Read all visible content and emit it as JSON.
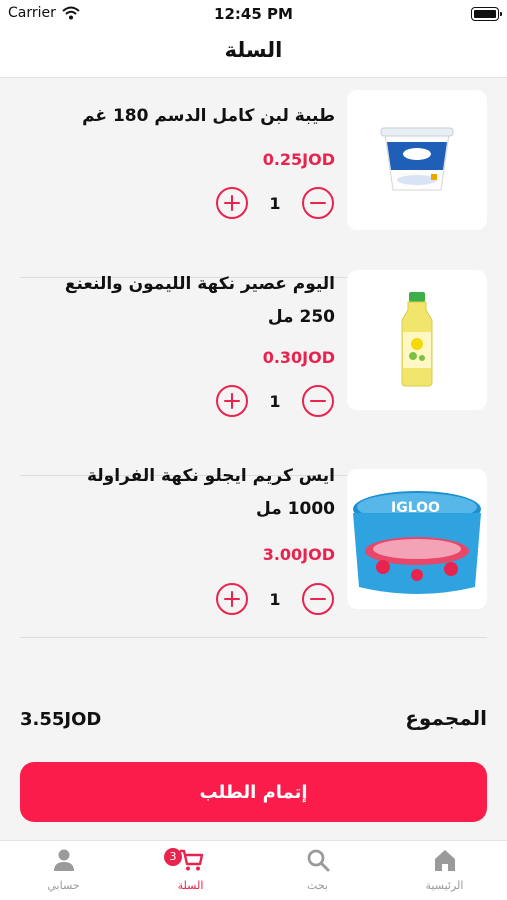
{
  "status_bar": {
    "carrier": "Carrier",
    "time": "12:45 PM"
  },
  "header": {
    "title": "السلة"
  },
  "cart": {
    "items": [
      {
        "name": "طيبة لبن كامل الدسم 180 غم",
        "price": "0.25JOD",
        "quantity": "1",
        "image_icon": "yogurt-cup-icon"
      },
      {
        "name": "اليوم عصير نكهة الليمون والنعنع 250 مل",
        "price": "0.30JOD",
        "quantity": "1",
        "image_icon": "juice-bottle-icon"
      },
      {
        "name": "ايس كريم ايجلو نكهة الفراولة 1000 مل",
        "price": "3.00JOD",
        "quantity": "1",
        "image_icon": "ice-cream-tub-icon"
      }
    ],
    "total_label": "المجموع",
    "total_value": "3.55JOD",
    "checkout_label": "إتمام الطلب"
  },
  "tab_bar": {
    "tabs": [
      {
        "label": "حسابي",
        "icon": "person-icon"
      },
      {
        "label": "السلة",
        "icon": "cart-icon",
        "badge": "3",
        "active": true
      },
      {
        "label": "بحث",
        "icon": "search-icon"
      },
      {
        "label": "الرئيسية",
        "icon": "home-icon"
      }
    ]
  },
  "colors": {
    "accent": "#e8234d",
    "button": "#fa1d4c",
    "background": "#f4f4f4"
  }
}
